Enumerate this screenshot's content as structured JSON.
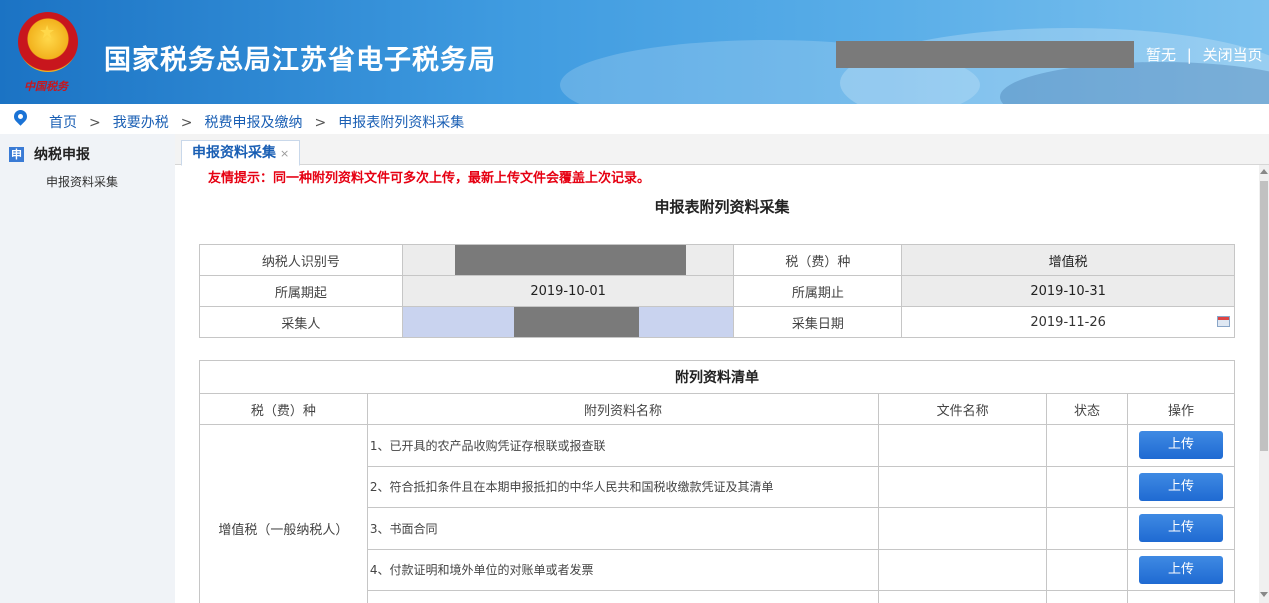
{
  "header": {
    "site_title": "国家税务总局江苏省电子税务局",
    "emblem_text": "中国税务",
    "links": [
      "暂无",
      "关闭当页"
    ],
    "separator": "|"
  },
  "breadcrumb": {
    "items": [
      "首页",
      "我要办税",
      "税费申报及缴纳",
      "申报表附列资料采集"
    ],
    "separator": ">"
  },
  "sidebar": {
    "badge": "申",
    "heading": "纳税申报",
    "items": [
      "申报资料采集"
    ]
  },
  "tabs": [
    {
      "label": "申报资料采集",
      "close": "×"
    }
  ],
  "notice": "友情提示：同一种附列资料文件可多次上传，最新上传文件会覆盖上次记录。",
  "page_title": "申报表附列资料采集",
  "info": {
    "taxpayer_id_label": "纳税人识别号",
    "tax_type_label": "税（费）种",
    "tax_type_value": "增值税",
    "period_start_label": "所属期起",
    "period_start_value": "2019-10-01",
    "period_end_label": "所属期止",
    "period_end_value": "2019-10-31",
    "collector_label": "采集人",
    "collect_date_label": "采集日期",
    "collect_date_value": "2019-11-26"
  },
  "attachments": {
    "caption": "附列资料清单",
    "columns": [
      "税（费）种",
      "附列资料名称",
      "文件名称",
      "状态",
      "操作"
    ],
    "tax_type": "增值税（一般纳税人）",
    "rows": [
      {
        "name": "1、已开具的农产品收购凭证存根联或报查联",
        "file": "",
        "status": "",
        "action": "上传"
      },
      {
        "name": "2、符合抵扣条件且在本期申报抵扣的中华人民共和国税收缴款凭证及其清单",
        "file": "",
        "status": "",
        "action": "上传"
      },
      {
        "name": "3、书面合同",
        "file": "",
        "status": "",
        "action": "上传"
      },
      {
        "name": "4、付款证明和境外单位的对账单或者发票",
        "file": "",
        "status": "",
        "action": "上传"
      }
    ]
  },
  "colors": {
    "banner": "#1b73c4",
    "link": "#1a5fb4",
    "notice": "#e60012",
    "button": "#2a78dc"
  }
}
